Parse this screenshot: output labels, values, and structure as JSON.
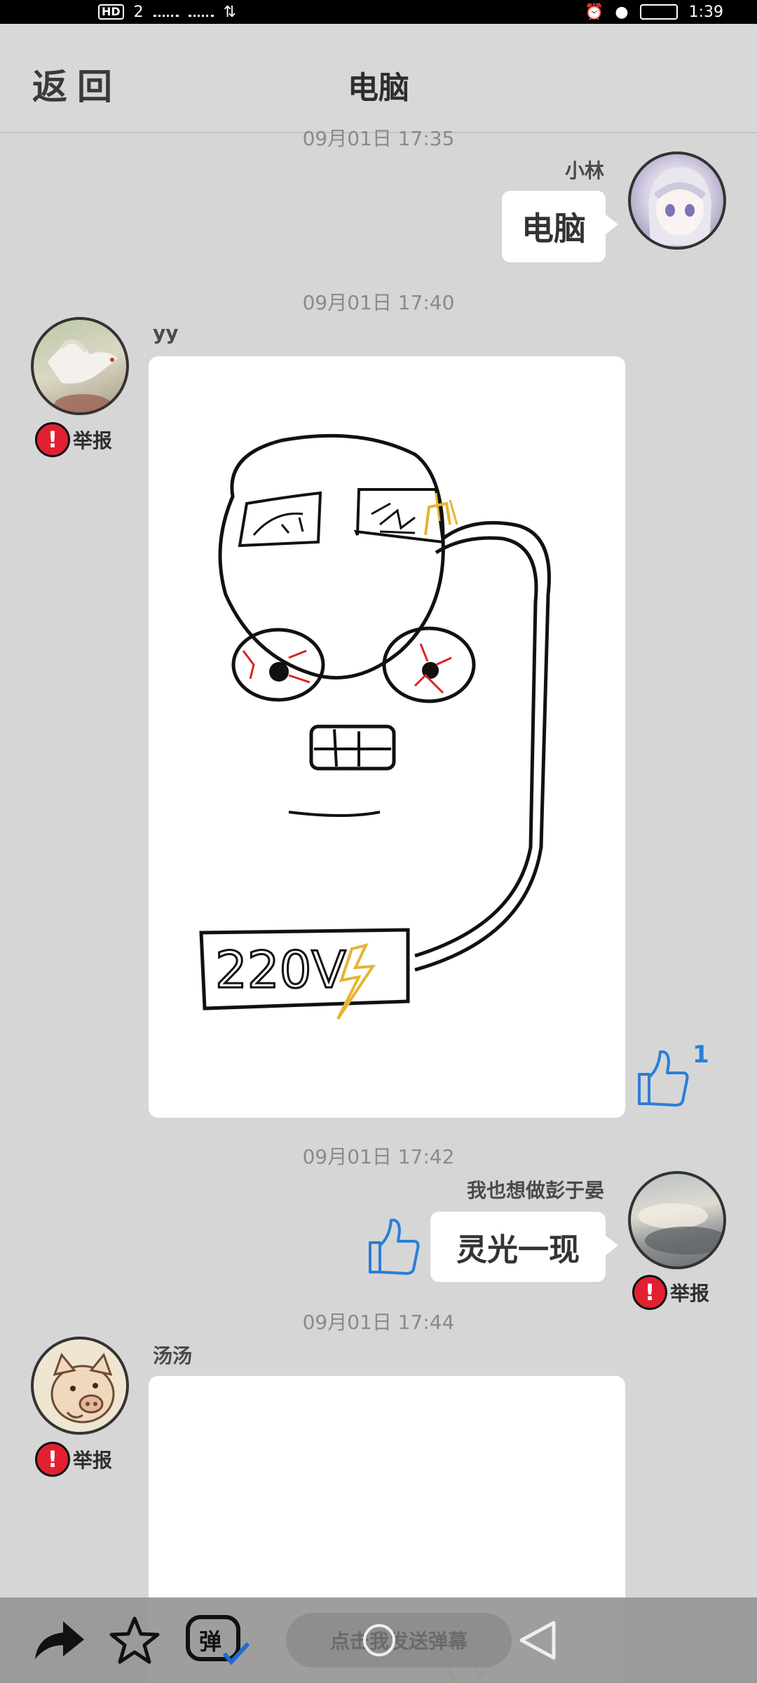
{
  "status_bar": {
    "hd": "HD",
    "sim": "2",
    "time": "1:39"
  },
  "header": {
    "back_label": "返回",
    "title": "电脑"
  },
  "messages": [
    {
      "timestamp": "09月01日 17:35",
      "sender": "小林",
      "side": "right",
      "text": "电脑"
    },
    {
      "timestamp": "09月01日 17:40",
      "sender": "yy",
      "side": "left",
      "type": "image",
      "report_label": "举报",
      "likes": "1",
      "image_text": "220V"
    },
    {
      "timestamp": "09月01日 17:42",
      "sender": "我也想做彭于晏",
      "side": "right",
      "text": "灵光一现",
      "report_label": "举报"
    },
    {
      "timestamp": "09月01日 17:44",
      "sender": "汤汤",
      "side": "left",
      "type": "image",
      "report_label": "举报"
    }
  ],
  "bottom_bar": {
    "danmaku_placeholder": "点击我发送弹幕",
    "danmaku_icon_text": "弹"
  },
  "colors": {
    "report_red": "#e32032",
    "like_blue": "#2a7ed8",
    "background": "#d6d6d6"
  }
}
